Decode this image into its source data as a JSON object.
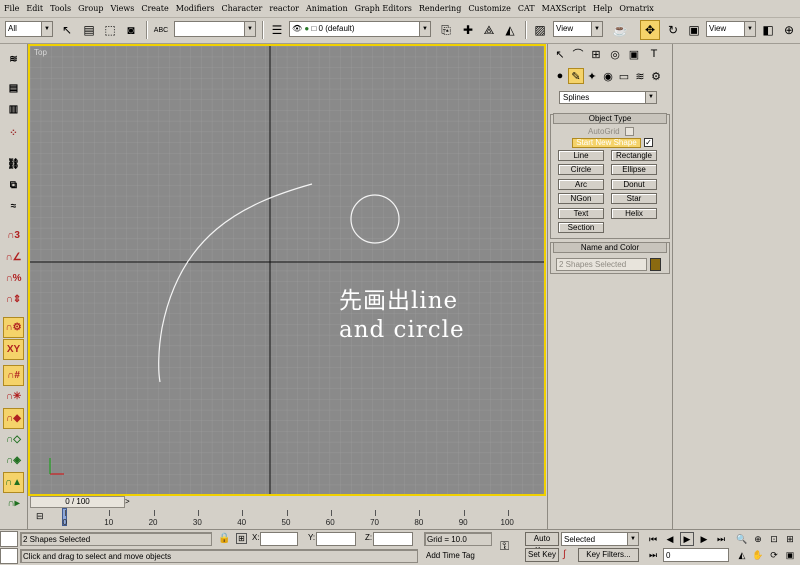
{
  "menu": [
    "File",
    "Edit",
    "Tools",
    "Group",
    "Views",
    "Create",
    "Modifiers",
    "Character",
    "reactor",
    "Animation",
    "Graph Editors",
    "Rendering",
    "Customize",
    "CAT",
    "MAXScript",
    "Help",
    "Ornatrix"
  ],
  "toolbar": {
    "selection_filter": "All",
    "named_selection": "",
    "layer": "0 (default)",
    "ref_coord": "View",
    "ref_coord2": "View",
    "abc_label": "ABC"
  },
  "viewport": {
    "label": "Top",
    "overlay_line1": "先画出line",
    "overlay_line2": "and circle",
    "grid_color": "#9a9a9a",
    "bg_color": "#8a8a8a"
  },
  "timeslider": {
    "frame": "0 / 100",
    "next": ">"
  },
  "trackbar": {
    "ticks": [
      "0",
      "10",
      "20",
      "30",
      "40",
      "50",
      "60",
      "70",
      "80",
      "90",
      "100"
    ]
  },
  "cmdpanel": {
    "category": "Splines",
    "object_type_title": "Object Type",
    "autogrid": "AutoGrid",
    "start_new_shape": "Start New Shape",
    "start_new_shape_checked": "✓",
    "buttons": [
      "Line",
      "Rectangle",
      "Circle",
      "Ellipse",
      "Arc",
      "Donut",
      "NGon",
      "Star",
      "Text",
      "Helix",
      "Section"
    ],
    "name_color_title": "Name and Color",
    "name_field": "2 Shapes Selected",
    "color_swatch": "#8a6a10"
  },
  "status": {
    "selection": "2 Shapes Selected",
    "prompt": "Click and drag to select and move objects",
    "x_label": "X:",
    "y_label": "Y:",
    "z_label": "Z:",
    "grid": "Grid = 10.0",
    "add_time_tag": "Add Time Tag",
    "auto_key": "Auto Key",
    "set_key": "Set Key",
    "key_mode": "Selected",
    "key_filters": "Key Filters...",
    "frame_field": "0"
  }
}
